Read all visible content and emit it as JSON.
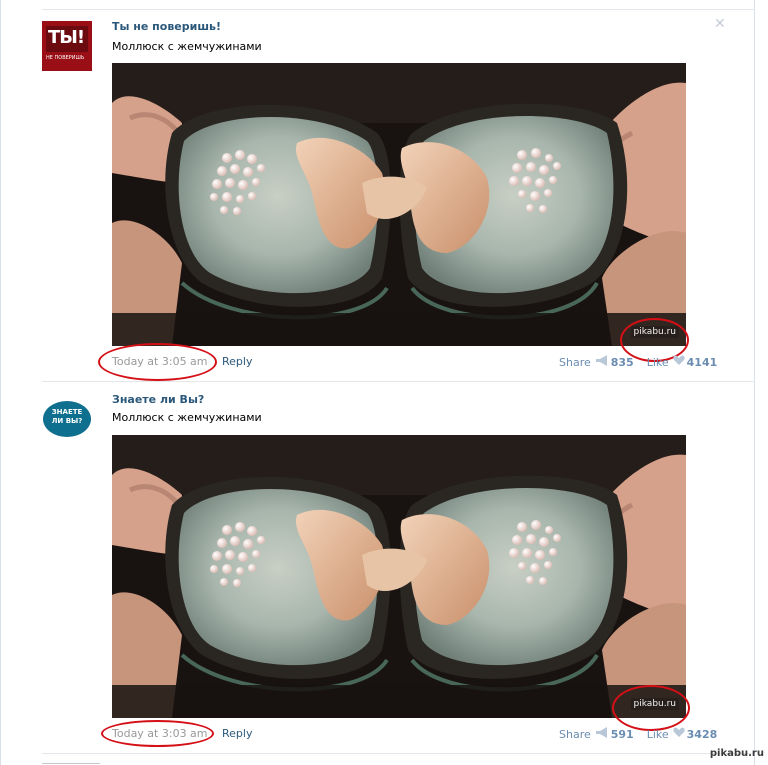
{
  "posts": [
    {
      "author": "Ты не поверишь!",
      "avatar_text": "ТЫ!",
      "avatar_sub": "НЕ ПОВЕРИШЬ",
      "text": "Моллюск с жемчужинами",
      "watermark": "pikabu.ru",
      "date": "Today at 3:05 am",
      "reply_label": "Reply",
      "share_label": "Share",
      "share_count": "835",
      "like_label": "Like",
      "like_count": "4141",
      "icons": [
        "megaphone-icon",
        "heart-icon",
        "close-icon"
      ]
    },
    {
      "author": "Знаете ли Вы?",
      "avatar_text": "ЗНАЕТЕ ЛИ ВЫ?",
      "text": "Моллюск с жемчужинами",
      "watermark": "pikabu.ru",
      "date": "Today at 3:03 am",
      "reply_label": "Reply",
      "share_label": "Share",
      "share_count": "591",
      "like_label": "Like",
      "like_count": "3428",
      "icons": [
        "megaphone-icon",
        "heart-icon"
      ]
    }
  ],
  "site_mark": "pikabu.ru",
  "colors": {
    "link": "#2b587a",
    "meta": "#999999",
    "stats": "#6b8db1",
    "highlight": "#d40f16"
  }
}
